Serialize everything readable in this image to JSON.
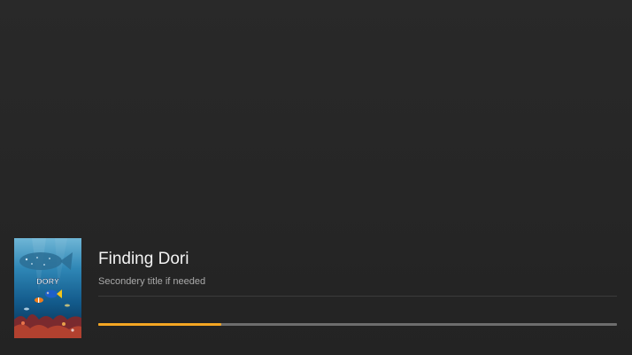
{
  "media": {
    "title": "Finding Dori",
    "subtitle": "Secondery title if needed",
    "poster_icon": "movie-poster-image",
    "poster_text": "DORY"
  },
  "playback": {
    "progress_fraction": 0.237
  },
  "colors": {
    "progress_fill": "#f4a623",
    "progress_track": "#6d6d6d",
    "title_text": "#f2f2f2",
    "subtitle_text": "#a9a9a9"
  }
}
